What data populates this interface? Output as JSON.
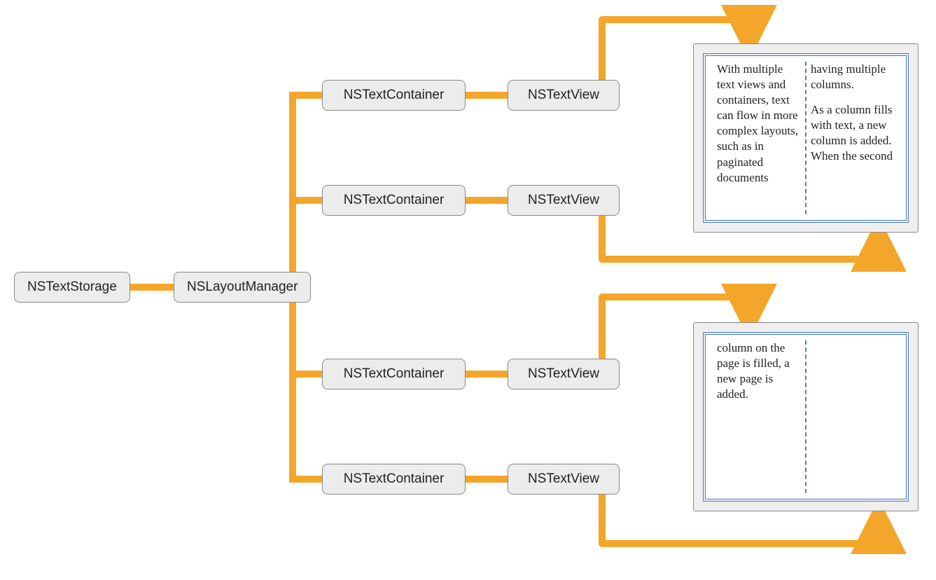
{
  "nodes": {
    "storage": "NSTextStorage",
    "layout": "NSLayoutManager",
    "container1": "NSTextContainer",
    "container2": "NSTextContainer",
    "container3": "NSTextContainer",
    "container4": "NSTextContainer",
    "view1": "NSTextView",
    "view2": "NSTextView",
    "view3": "NSTextView",
    "view4": "NSTextView"
  },
  "pages": {
    "p1": {
      "col1": "With multiple text views and containers, text can flow in more complex layouts, such as in paginated documents",
      "col2a": "having multiple columns.",
      "col2b": "As a column fills with text, a new column is added. When the second"
    },
    "p2": {
      "col1": "column on the page is filled, a new page is added.",
      "col2": ""
    }
  },
  "colors": {
    "connector": "#f4a62a",
    "nodeFill": "#ececec",
    "nodeBorder": "#888888",
    "pageBorder": "#4a7dbf"
  }
}
